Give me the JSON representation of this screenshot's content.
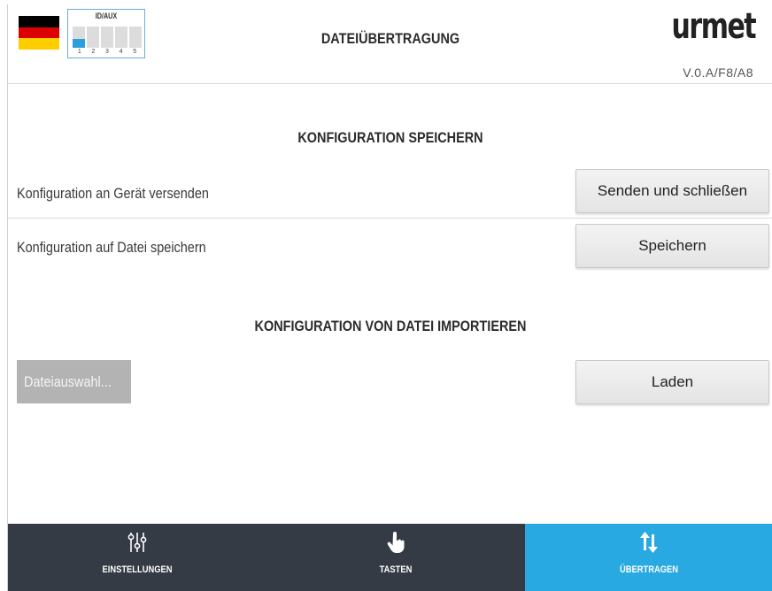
{
  "header": {
    "title": "DATEIÜBERTRAGUNG",
    "dip_switch": {
      "label": "ID/AUX",
      "numbers": [
        "1",
        "2",
        "3",
        "4",
        "5"
      ],
      "states": [
        true,
        false,
        false,
        false,
        false
      ]
    },
    "flag_colors": [
      "#000000",
      "#dd0000",
      "#ffce00"
    ],
    "logo_text": "urmet",
    "version": "V.0.A/F8/A8"
  },
  "save_section": {
    "title": "KONFIGURATION SPEICHERN",
    "rows": [
      {
        "label": "Konfiguration an Gerät versenden",
        "button": "Senden und schließen"
      },
      {
        "label": "Konfiguration auf Datei speichern",
        "button": "Speichern"
      }
    ]
  },
  "import_section": {
    "title": "KONFIGURATION VON DATEI IMPORTIEREN",
    "file_button": "Dateiauswahl...",
    "load_button": "Laden"
  },
  "nav": {
    "items": [
      {
        "label": "EINSTELLUNGEN",
        "icon": "sliders-icon",
        "active": false
      },
      {
        "label": "TASTEN",
        "icon": "hand-pointer-icon",
        "active": false
      },
      {
        "label": "ÜBERTRAGEN",
        "icon": "transfer-arrows-icon",
        "active": true
      }
    ],
    "active_color": "#29a9e1",
    "base_color": "#343b45"
  }
}
